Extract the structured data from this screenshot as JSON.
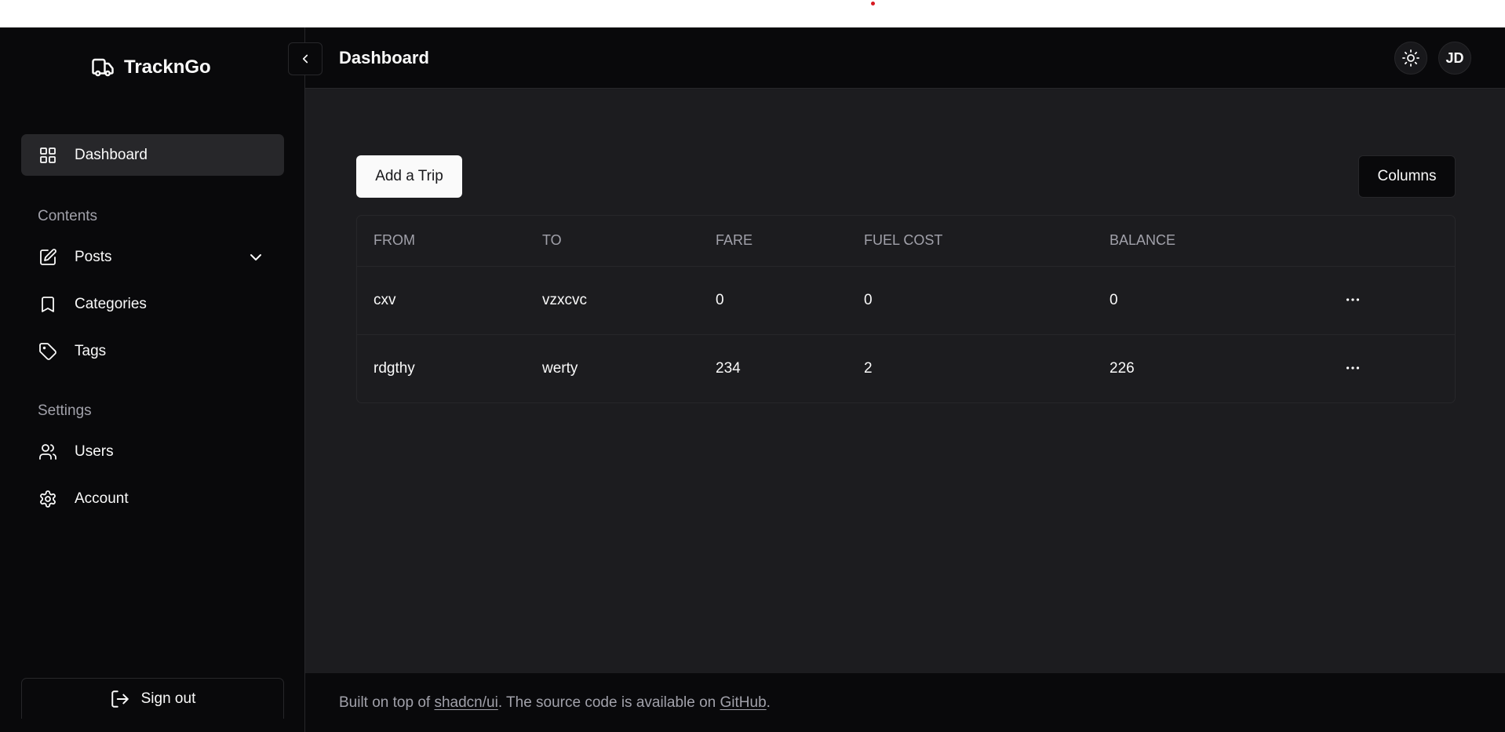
{
  "brand": {
    "name": "TracknGo"
  },
  "sidebar": {
    "items": [
      {
        "label": "Dashboard",
        "icon": "layout-grid-icon",
        "active": true
      },
      {
        "label": "Posts",
        "icon": "pencil-square-icon"
      },
      {
        "label": "Categories",
        "icon": "bookmark-icon"
      },
      {
        "label": "Tags",
        "icon": "tag-icon"
      },
      {
        "label": "Users",
        "icon": "users-icon"
      },
      {
        "label": "Account",
        "icon": "gear-icon"
      }
    ],
    "sections": {
      "contents": "Contents",
      "settings": "Settings"
    },
    "signout_label": "Sign out"
  },
  "header": {
    "title": "Dashboard",
    "avatar_initials": "JD"
  },
  "toolbar": {
    "add_trip_label": "Add a Trip",
    "columns_label": "Columns"
  },
  "table": {
    "headers": [
      "FROM",
      "TO",
      "FARE",
      "FUEL COST",
      "BALANCE"
    ],
    "rows": [
      [
        "cxv",
        "vzxcvc",
        "0",
        "0",
        "0"
      ],
      [
        "rdgthy",
        "werty",
        "234",
        "2",
        "226"
      ]
    ]
  },
  "footer": {
    "prefix": "Built on top of ",
    "link1": "shadcn/ui",
    "middle": ". The source code is available on ",
    "link2": "GitHub",
    "suffix": "."
  },
  "colors": {
    "sidebar_bg": "#09090b",
    "main_bg": "#1c1c1f",
    "accent": "#fafafa",
    "muted": "#a1a1aa",
    "border": "#27272a",
    "top_dot": "#d71920"
  }
}
